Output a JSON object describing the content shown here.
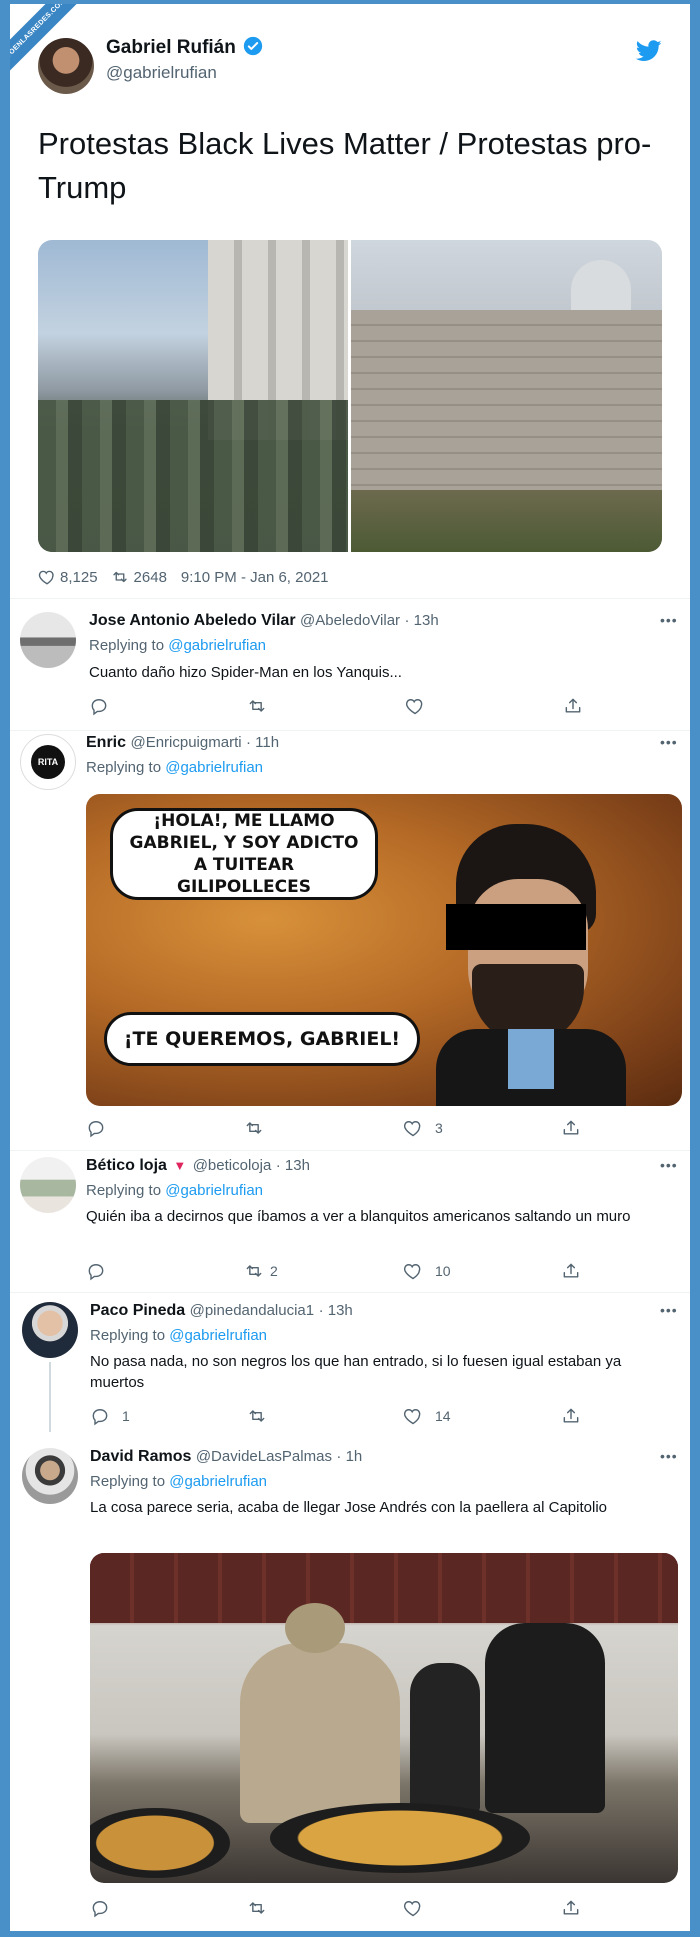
{
  "watermark": "VISTOENLASREDES.COM",
  "main_tweet": {
    "author": "Gabriel Rufián",
    "handle": "@gabrielrufian",
    "text": "Protestas Black Lives Matter / Protestas pro-Trump",
    "likes": "8,125",
    "retweets": "2648",
    "timestamp": "9:10 PM - Jan 6, 2021"
  },
  "replies": [
    {
      "author": "Jose Antonio Abeledo Vilar",
      "handle": "@AbeledoVilar",
      "time": "· 13h",
      "replying_prefix": "Replying to",
      "replying_to": "@gabrielrufian",
      "text": "Cuanto daño hizo Spider-Man en los Yanquis...",
      "reply_count": "",
      "retweet_count": "",
      "like_count": ""
    },
    {
      "author": "Enric",
      "handle": "@Enricpuigmarti",
      "time": "· 11h",
      "replying_prefix": "Replying to",
      "replying_to": "@gabrielrufian",
      "text": "",
      "avatar_text": "RITA",
      "meme_top": "¡HOLA!, ME LLAMO GABRIEL, Y SOY ADICTO A TUITEAR GILIPOLLECES",
      "meme_bottom": "¡TE QUEREMOS, GABRIEL!",
      "reply_count": "",
      "retweet_count": "",
      "like_count": "3"
    },
    {
      "author": "Bético loja",
      "handle": "@beticoloja",
      "time": "· 13h",
      "replying_prefix": "Replying to",
      "replying_to": "@gabrielrufian",
      "text": "Quién iba a decirnos que íbamos a ver a blanquitos americanos saltando un muro",
      "reply_count": "",
      "retweet_count": "2",
      "like_count": "10"
    },
    {
      "author": "Paco Pineda",
      "handle": "@pinedandalucia1",
      "time": "· 13h",
      "replying_prefix": "Replying to",
      "replying_to": "@gabrielrufian",
      "text": "No pasa nada, no son negros los que han entrado, si lo fuesen igual estaban ya muertos",
      "reply_count": "1",
      "retweet_count": "",
      "like_count": "14"
    },
    {
      "author": "David Ramos",
      "handle": "@DavideLasPalmas",
      "time": "· 1h",
      "replying_prefix": "Replying to",
      "replying_to": "@gabrielrufian",
      "text": "La cosa parece seria, acaba de llegar Jose Andrés con la paellera al Capitolio",
      "reply_count": "",
      "retweet_count": "",
      "like_count": ""
    }
  ],
  "colors": {
    "verified": "#1d9bf0",
    "link": "#1d9bf0",
    "muted": "#536471",
    "frame": "#4a90c8"
  },
  "icons": [
    "verified-badge-icon",
    "twitter-bird-icon",
    "heart-icon",
    "retweet-icon",
    "reply-icon",
    "share-icon",
    "more-icon"
  ]
}
